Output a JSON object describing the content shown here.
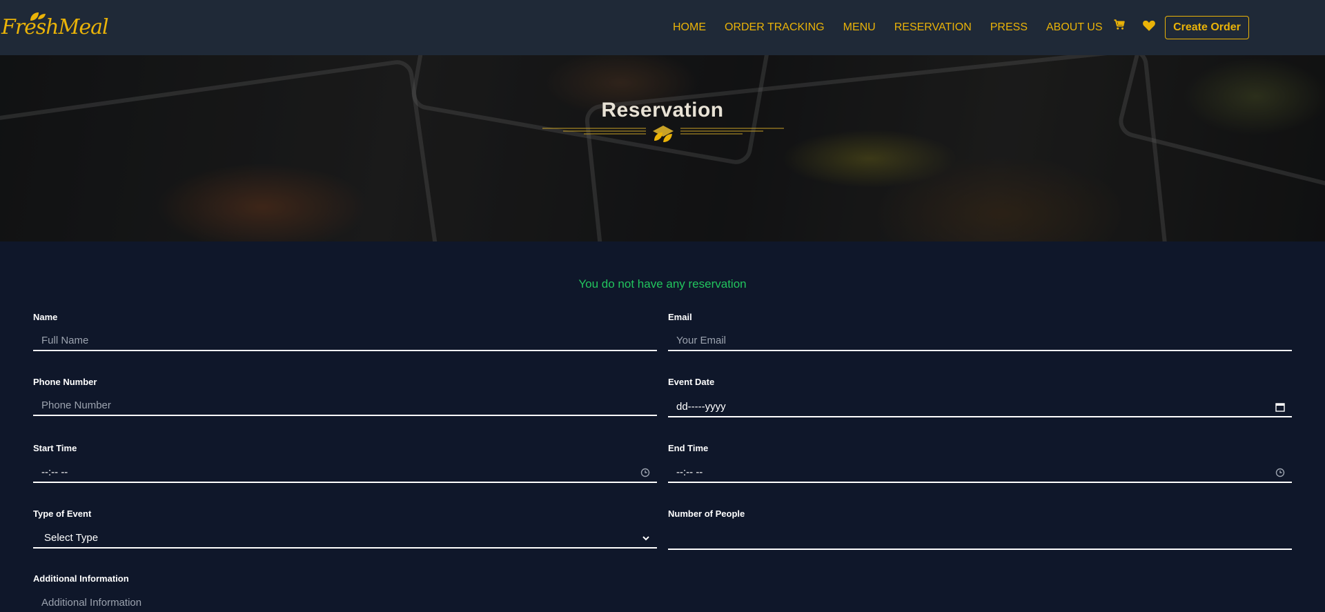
{
  "brand": {
    "name": "FreshMeal"
  },
  "nav": {
    "links": [
      "HOME",
      "ORDER TRACKING",
      "MENU",
      "RESERVATION",
      "PRESS",
      "ABOUT US"
    ],
    "icons": [
      "cart-icon",
      "heart-icon"
    ],
    "create_order_label": "Create Order"
  },
  "hero": {
    "title": "Reservation"
  },
  "status_message": "You do not have any reservation",
  "form": {
    "name": {
      "label": "Name",
      "placeholder": "Full Name"
    },
    "email": {
      "label": "Email",
      "placeholder": "Your Email"
    },
    "phone": {
      "label": "Phone Number",
      "placeholder": "Phone Number"
    },
    "event_date": {
      "label": "Event Date",
      "value": "dd-----yyyy",
      "icon": "calendar-icon"
    },
    "start_time": {
      "label": "Start Time",
      "value": "--:-- --",
      "icon": "clock-icon"
    },
    "end_time": {
      "label": "End Time",
      "value": "--:-- --",
      "icon": "clock-icon"
    },
    "event_type": {
      "label": "Type of Event",
      "selected": "Select Type",
      "icon": "chevron-down-icon"
    },
    "people": {
      "label": "Number of People",
      "value": ""
    },
    "additional": {
      "label": "Additional Information",
      "placeholder": "Additional Information"
    }
  },
  "colors": {
    "accent": "#eab308",
    "success": "#22c55e",
    "navbar": "#1f2937",
    "background": "#0f172a"
  }
}
